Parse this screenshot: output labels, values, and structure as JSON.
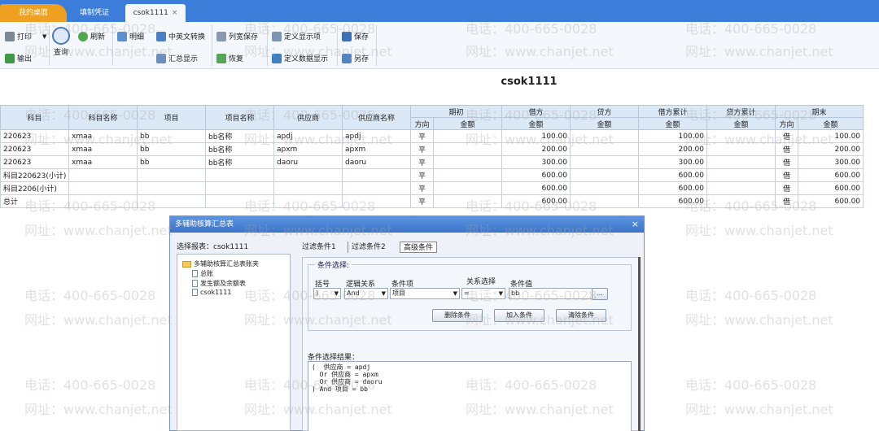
{
  "tabs": [
    {
      "label": "我的桌面"
    },
    {
      "label": "填制凭证"
    },
    {
      "label": "csok1111",
      "close": "×"
    }
  ],
  "toolbar": {
    "print": "打印",
    "export": "输出",
    "query": "查询",
    "refresh": "刷新",
    "detail": "明细",
    "cn_en": "中英文转换",
    "summary": "汇总显示",
    "col_save": "列宽保存",
    "restore": "恢复",
    "def_show": "定义显示项",
    "def_data": "定义数据显示",
    "save": "保存",
    "save_as": "另存"
  },
  "report": {
    "title": "csok1111"
  },
  "grid": {
    "headers": {
      "subject": "科目",
      "subject_name": "科目名称",
      "item": "项目",
      "item_name": "项目名称",
      "supplier": "供应商",
      "supplier_name": "供应商名称",
      "opening": "期初",
      "debit": "借方",
      "credit": "贷方",
      "debit_cum": "借方累计",
      "credit_cum": "贷方累计",
      "closing": "期末",
      "direction": "方向",
      "amount": "金额"
    },
    "rows": [
      {
        "subject": "220623",
        "subject_name": "xmaa",
        "item": "bb",
        "item_name": "bb名称",
        "supplier": "apdj",
        "supplier_name": "apdj",
        "dir1": "平",
        "opening": "",
        "debit": "100.00",
        "credit": "",
        "debit_cum": "100.00",
        "credit_cum": "",
        "dir2": "借",
        "closing": "100.00"
      },
      {
        "subject": "220623",
        "subject_name": "xmaa",
        "item": "bb",
        "item_name": "bb名称",
        "supplier": "apxm",
        "supplier_name": "apxm",
        "dir1": "平",
        "opening": "",
        "debit": "200.00",
        "credit": "",
        "debit_cum": "200.00",
        "credit_cum": "",
        "dir2": "借",
        "closing": "200.00"
      },
      {
        "subject": "220623",
        "subject_name": "xmaa",
        "item": "bb",
        "item_name": "bb名称",
        "supplier": "daoru",
        "supplier_name": "daoru",
        "dir1": "平",
        "opening": "",
        "debit": "300.00",
        "credit": "",
        "debit_cum": "300.00",
        "credit_cum": "",
        "dir2": "借",
        "closing": "300.00"
      },
      {
        "subject": "科目220623(小计)",
        "subject_name": "",
        "item": "",
        "item_name": "",
        "supplier": "",
        "supplier_name": "",
        "dir1": "平",
        "opening": "",
        "debit": "600.00",
        "credit": "",
        "debit_cum": "600.00",
        "credit_cum": "",
        "dir2": "借",
        "closing": "600.00"
      },
      {
        "subject": "科目2206(小计)",
        "subject_name": "",
        "item": "",
        "item_name": "",
        "supplier": "",
        "supplier_name": "",
        "dir1": "平",
        "opening": "",
        "debit": "600.00",
        "credit": "",
        "debit_cum": "600.00",
        "credit_cum": "",
        "dir2": "借",
        "closing": "600.00"
      },
      {
        "subject": "总计",
        "subject_name": "",
        "item": "",
        "item_name": "",
        "supplier": "",
        "supplier_name": "",
        "dir1": "平",
        "opening": "",
        "debit": "600.00",
        "credit": "",
        "debit_cum": "600.00",
        "credit_cum": "",
        "dir2": "借",
        "closing": "600.00"
      }
    ]
  },
  "dialog": {
    "title": "多辅助核算汇总表",
    "close": "×",
    "select_label": "选择报表：csok1111",
    "tree": [
      {
        "label": "多辅助核算汇总表账夹"
      },
      {
        "label": "总账"
      },
      {
        "label": "发生额及余额表"
      },
      {
        "label": "csok1111"
      }
    ],
    "tabs": [
      "过滤条件1",
      "过滤条件2",
      "高级条件"
    ],
    "fieldset_label": "条件选择:",
    "fields": {
      "bracket": "括号",
      "logic": "逻辑关系",
      "cond_item": "条件项",
      "relation": "关系选择",
      "cond_value": "条件值"
    },
    "values": {
      "bracket": ")",
      "logic": "And",
      "cond_item": "项目",
      "relation": "=",
      "cond_value": "bb",
      "ellipsis": "..."
    },
    "buttons": {
      "delete": "删除条件",
      "add": "加入条件",
      "clear": "清除条件"
    },
    "result_label": "条件选择结果：",
    "result_text": "(  供应商 = apdj\n  Or 供应商 = apxm\n  Or 供应商 = daoru\n) And 项目 = bb"
  },
  "watermark": {
    "phone": "电话：400-665-0028",
    "site": "网址：www.chanjet.net"
  }
}
